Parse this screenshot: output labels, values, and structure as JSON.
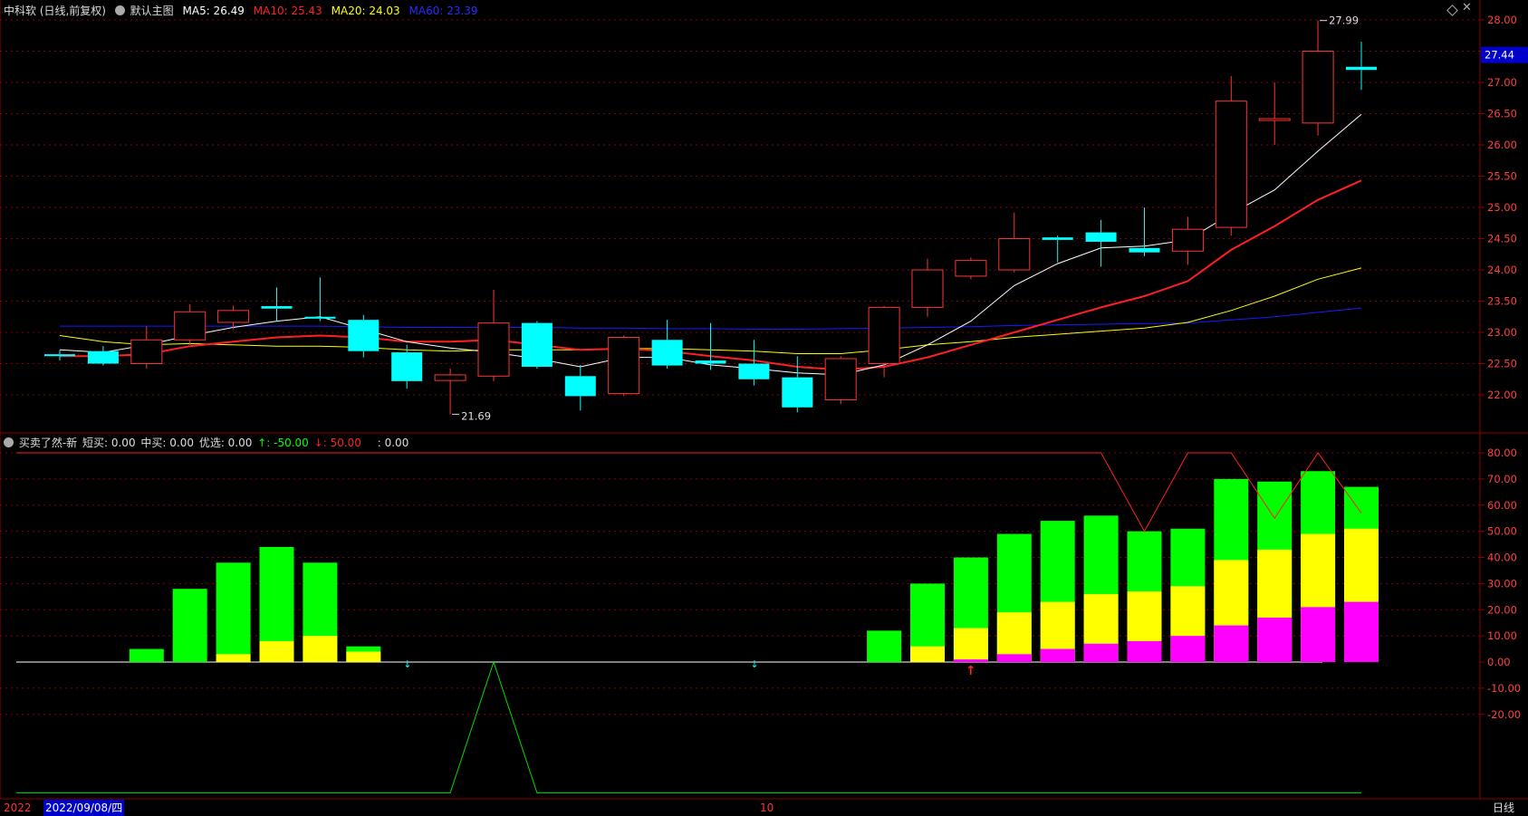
{
  "header_main": {
    "title": "中科软 (日线,前复权)",
    "preset": "默认主图",
    "ma5": "MA5: 26.49",
    "ma10": "MA10: 25.43",
    "ma20": "MA20: 24.03",
    "ma60": "MA60: 23.39"
  },
  "header_sub": {
    "title": "买卖了然-新",
    "short": "短买: 0.00",
    "mid": "中买: 0.00",
    "pick": "优选: 0.00",
    "up": "↑: -50.00",
    "down": "↓: 50.00",
    "blank": ": 0.00"
  },
  "footer": {
    "year_prefix": "2022",
    "date_box": "2022/09/08/四",
    "month_mark": "10",
    "period": "日线"
  },
  "colors": {
    "up": "#ff3333",
    "down": "#00ffff",
    "ma5": "#ffffff",
    "ma10": "#ff2020",
    "ma20": "#ffff00",
    "ma60": "#1a1aff",
    "green": "#00ff00",
    "yellow": "#ffff00",
    "magenta": "#ff00ff",
    "grid": "#8b0000"
  },
  "icons": [
    "settings-circle-icon",
    "diamond-icon",
    "close-icon"
  ],
  "chart_data": [
    {
      "type": "candlestick",
      "title": "中科软 (日线,前复权)",
      "ylim": [
        21.4,
        28.3
      ],
      "yticks": [
        "28.00",
        "27.50",
        "27.00",
        "26.50",
        "26.00",
        "25.50",
        "25.00",
        "24.50",
        "24.00",
        "23.50",
        "23.00",
        "22.50",
        "22.00"
      ],
      "current_price": "27.44",
      "annotations": [
        {
          "label": "27.99",
          "bar": 29,
          "value": 27.99
        },
        {
          "label": "21.69",
          "bar": 9,
          "value": 21.69
        }
      ],
      "ohlc": [
        [
          22.65,
          22.72,
          22.55,
          22.62
        ],
        [
          22.7,
          22.78,
          22.47,
          22.5
        ],
        [
          22.5,
          23.1,
          22.42,
          22.88
        ],
        [
          22.88,
          23.45,
          22.8,
          23.33
        ],
        [
          23.16,
          23.43,
          23.05,
          23.35
        ],
        [
          23.42,
          23.72,
          23.18,
          23.38
        ],
        [
          23.25,
          23.88,
          23.18,
          23.22
        ],
        [
          23.2,
          23.28,
          22.6,
          22.7
        ],
        [
          22.68,
          22.8,
          22.1,
          22.22
        ],
        [
          22.23,
          22.42,
          21.69,
          22.32
        ],
        [
          22.3,
          23.68,
          22.22,
          23.15
        ],
        [
          23.15,
          23.18,
          22.42,
          22.45
        ],
        [
          22.3,
          22.48,
          21.75,
          21.98
        ],
        [
          22.02,
          22.95,
          21.98,
          22.92
        ],
        [
          22.88,
          23.2,
          22.42,
          22.47
        ],
        [
          22.55,
          23.15,
          22.4,
          22.5
        ],
        [
          22.5,
          22.88,
          22.15,
          22.25
        ],
        [
          22.28,
          22.62,
          21.72,
          21.8
        ],
        [
          21.92,
          22.62,
          21.85,
          22.58
        ],
        [
          22.5,
          23.42,
          22.28,
          23.4
        ],
        [
          23.4,
          24.18,
          23.25,
          24.0
        ],
        [
          23.9,
          24.2,
          23.85,
          24.15
        ],
        [
          24.0,
          24.92,
          23.96,
          24.5
        ],
        [
          24.52,
          24.55,
          24.12,
          24.48
        ],
        [
          24.6,
          24.8,
          24.05,
          24.45
        ],
        [
          24.35,
          25.0,
          24.22,
          24.28
        ],
        [
          24.3,
          24.85,
          24.08,
          24.65
        ],
        [
          24.68,
          27.1,
          24.55,
          26.7
        ],
        [
          26.42,
          27.0,
          26.0,
          26.42
        ],
        [
          26.35,
          27.99,
          26.15,
          27.5
        ],
        [
          27.25,
          27.65,
          26.88,
          27.2
        ]
      ],
      "ma5": [
        22.72,
        22.68,
        22.8,
        22.95,
        23.08,
        23.18,
        23.25,
        23.05,
        22.85,
        22.75,
        22.68,
        22.58,
        22.45,
        22.6,
        22.6,
        22.48,
        22.42,
        22.35,
        22.32,
        22.48,
        22.8,
        23.18,
        23.75,
        24.1,
        24.35,
        24.38,
        24.48,
        24.9,
        25.28,
        25.9,
        26.49
      ],
      "ma10": [
        22.62,
        22.62,
        22.65,
        22.78,
        22.85,
        22.92,
        22.95,
        22.92,
        22.85,
        22.85,
        22.88,
        22.8,
        22.72,
        22.74,
        22.7,
        22.62,
        22.55,
        22.45,
        22.4,
        22.45,
        22.6,
        22.8,
        23.0,
        23.2,
        23.4,
        23.58,
        23.82,
        24.32,
        24.7,
        25.12,
        25.43
      ],
      "ma20": [
        22.95,
        22.85,
        22.8,
        22.82,
        22.8,
        22.78,
        22.78,
        22.76,
        22.72,
        22.7,
        22.72,
        22.72,
        22.72,
        22.74,
        22.74,
        22.72,
        22.7,
        22.66,
        22.66,
        22.72,
        22.8,
        22.85,
        22.92,
        22.97,
        23.02,
        23.07,
        23.16,
        23.35,
        23.58,
        23.85,
        24.03
      ],
      "ma60": [
        23.1,
        23.1,
        23.1,
        23.1,
        23.1,
        23.1,
        23.1,
        23.09,
        23.08,
        23.08,
        23.08,
        23.08,
        23.07,
        23.07,
        23.06,
        23.06,
        23.05,
        23.05,
        23.06,
        23.07,
        23.08,
        23.09,
        23.11,
        23.12,
        23.13,
        23.14,
        23.15,
        23.2,
        23.25,
        23.32,
        23.39
      ]
    },
    {
      "type": "bar",
      "title": "买卖了然-新",
      "ylim": [
        -50,
        85
      ],
      "yticks": [
        "80.00",
        "70.00",
        "60.00",
        "50.00",
        "40.00",
        "30.00",
        "20.00",
        "10.00",
        "0.00",
        "-10.00",
        "-20.00"
      ],
      "series": [
        {
          "name": "green",
          "values": [
            0,
            0,
            5,
            28,
            38,
            44,
            38,
            6,
            0,
            0,
            0,
            0,
            0,
            0,
            0,
            0,
            0,
            0,
            0,
            12,
            30,
            40,
            49,
            54,
            56,
            50,
            51,
            70,
            69,
            73,
            67
          ]
        },
        {
          "name": "yellow",
          "values": [
            0,
            0,
            0,
            0,
            3,
            8,
            10,
            4,
            0,
            0,
            0,
            0,
            0,
            0,
            0,
            0,
            0,
            0,
            0,
            0,
            6,
            13,
            19,
            23,
            26,
            27,
            29,
            39,
            43,
            49,
            51
          ]
        },
        {
          "name": "magenta",
          "values": [
            0,
            0,
            0,
            0,
            0,
            0,
            0,
            0,
            0,
            0,
            0,
            0,
            0,
            0,
            0,
            0,
            0,
            0,
            0,
            0,
            0,
            1,
            3,
            5,
            7,
            8,
            10,
            14,
            17,
            21,
            23
          ]
        },
        {
          "name": "red-line",
          "values": [
            80,
            80,
            80,
            80,
            80,
            80,
            80,
            80,
            80,
            80,
            80,
            80,
            80,
            80,
            80,
            80,
            80,
            80,
            80,
            80,
            80,
            80,
            80,
            80,
            80,
            50,
            80,
            80,
            55,
            80,
            57
          ]
        },
        {
          "name": "green-line",
          "values": [
            -50,
            -50,
            -50,
            -50,
            -50,
            -50,
            -50,
            -50,
            -50,
            -50,
            0,
            -50,
            -50,
            -50,
            -50,
            -50,
            -50,
            -50,
            -50,
            -50,
            -50,
            -50,
            -50,
            -50,
            -50,
            -50,
            -50,
            -50,
            -50,
            -50,
            -50
          ]
        }
      ],
      "signals": [
        {
          "type": "red-up-arrow",
          "bar": 21
        },
        {
          "type": "cyan-down-arrow",
          "bar": 8
        },
        {
          "type": "cyan-down-arrow",
          "bar": 16
        }
      ]
    }
  ]
}
